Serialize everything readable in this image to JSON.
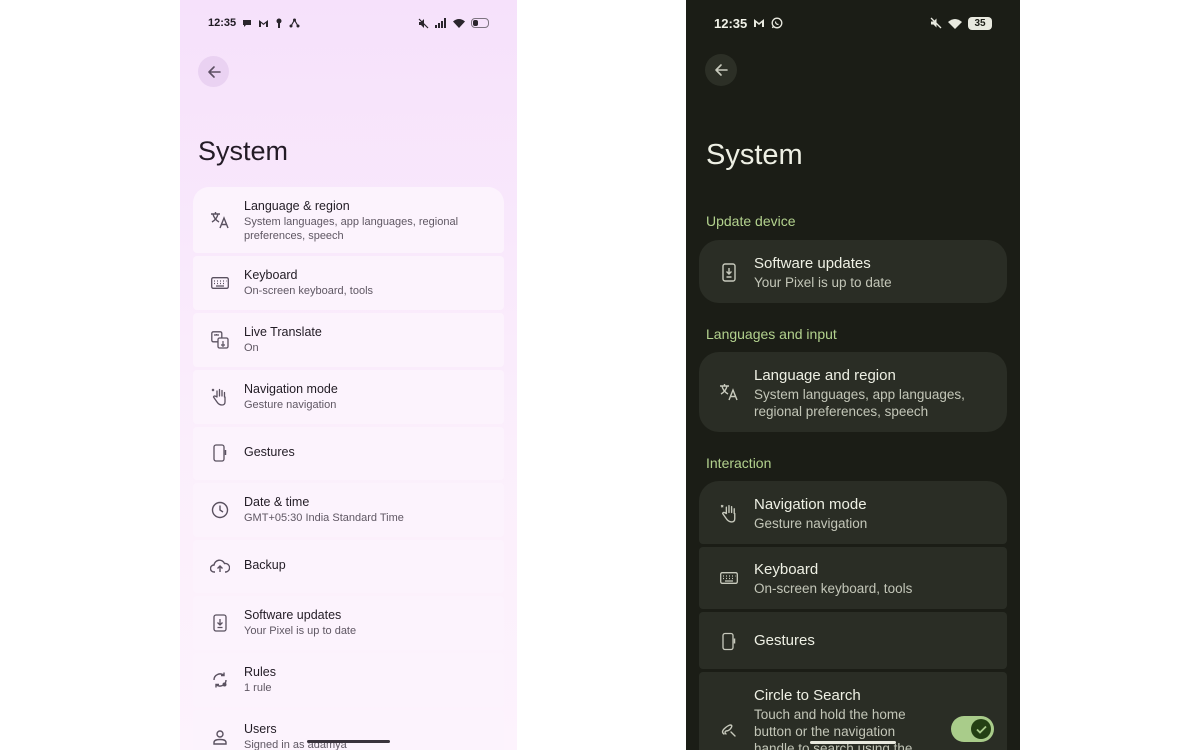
{
  "light": {
    "status": {
      "time": "12:35"
    },
    "title": "System",
    "items": [
      {
        "title": "Language & region",
        "subtitle": "System languages, app languages, regional preferences, speech",
        "icon": "translate-icon"
      },
      {
        "title": "Keyboard",
        "subtitle": "On-screen keyboard, tools",
        "icon": "keyboard-icon"
      },
      {
        "title": "Live Translate",
        "subtitle": "On",
        "icon": "live-translate-icon"
      },
      {
        "title": "Navigation mode",
        "subtitle": "Gesture navigation",
        "icon": "gesture-hand-icon"
      },
      {
        "title": "Gestures",
        "subtitle": "",
        "icon": "phone-gesture-icon"
      },
      {
        "title": "Date & time",
        "subtitle": "GMT+05:30 India Standard Time",
        "icon": "clock-icon"
      },
      {
        "title": "Backup",
        "subtitle": "",
        "icon": "cloud-upload-icon"
      },
      {
        "title": "Software updates",
        "subtitle": "Your Pixel is up to date",
        "icon": "system-update-icon"
      },
      {
        "title": "Rules",
        "subtitle": "1 rule",
        "icon": "rules-icon"
      },
      {
        "title": "Users",
        "subtitle": "Signed in as adamya",
        "icon": "person-icon"
      }
    ]
  },
  "dark": {
    "status": {
      "time": "12:35",
      "battery": "35"
    },
    "title": "System",
    "sections": [
      {
        "label": "Update device"
      },
      {
        "label": "Languages and input"
      },
      {
        "label": "Interaction"
      }
    ],
    "items": [
      {
        "title": "Software updates",
        "subtitle": "Your Pixel is up to date",
        "icon": "system-update-icon"
      },
      {
        "title": "Language and region",
        "subtitle": "System languages, app languages, regional preferences, speech",
        "icon": "translate-icon"
      },
      {
        "title": "Navigation mode",
        "subtitle": "Gesture navigation",
        "icon": "gesture-hand-icon"
      },
      {
        "title": "Keyboard",
        "subtitle": "On-screen keyboard, tools",
        "icon": "keyboard-icon"
      },
      {
        "title": "Gestures",
        "subtitle": "",
        "icon": "phone-gesture-icon"
      },
      {
        "title": "Circle to Search",
        "subtitle": "Touch and hold the home button or the navigation handle to search using the",
        "icon": "circle-to-search-icon",
        "toggle": true
      }
    ]
  },
  "colors": {
    "light_bg": "#f6e1fb",
    "light_card": "#fcf3fd",
    "dark_bg": "#1b1d16",
    "dark_card": "#2a2d25",
    "dark_accent": "#b3d28e",
    "toggle_on": "#a9cc8a"
  }
}
